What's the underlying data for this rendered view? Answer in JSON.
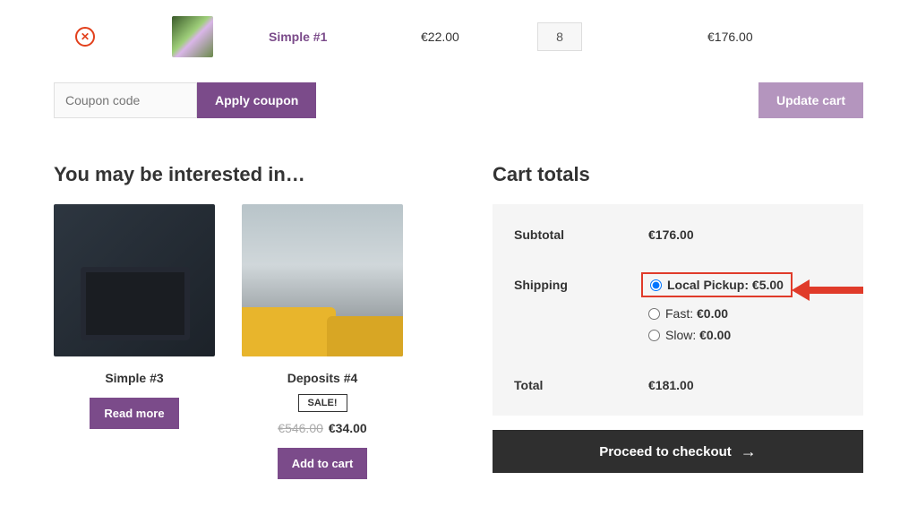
{
  "cart": {
    "items": [
      {
        "name": "Simple #1",
        "price": "€22.00",
        "qty": "8",
        "subtotal": "€176.00"
      }
    ],
    "coupon_placeholder": "Coupon code",
    "apply_label": "Apply coupon",
    "update_label": "Update cart"
  },
  "interested": {
    "heading": "You may be interested in…",
    "products": [
      {
        "title": "Simple #3",
        "button": "Read more"
      },
      {
        "title": "Deposits #4",
        "sale_badge": "SALE!",
        "old_price": "€546.00",
        "price": "€34.00",
        "button": "Add to cart"
      }
    ]
  },
  "totals": {
    "heading": "Cart totals",
    "subtotal_label": "Subtotal",
    "subtotal_value": "€176.00",
    "shipping_label": "Shipping",
    "shipping_options": [
      {
        "label": "Local Pickup:",
        "price": "€5.00",
        "selected": true
      },
      {
        "label": "Fast:",
        "price": "€0.00",
        "selected": false
      },
      {
        "label": "Slow:",
        "price": "€0.00",
        "selected": false
      }
    ],
    "total_label": "Total",
    "total_value": "€181.00",
    "checkout_label": "Proceed to checkout"
  }
}
